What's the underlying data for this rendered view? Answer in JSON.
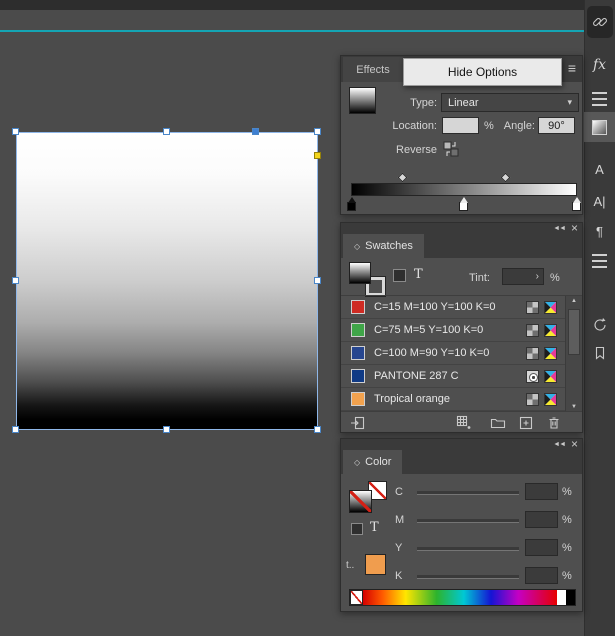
{
  "icons": {
    "menu": "≡",
    "collapse": "◄◄",
    "close": "×",
    "diamond": "◇",
    "chevron_down": "▾",
    "chevron_right": "›",
    "scroll_up": "▲",
    "scroll_down": "▼",
    "fx": "fx",
    "character": "A",
    "character_styles": "A|",
    "paragraph": "¶",
    "text_tool": "T",
    "tint_abbrev": "t.."
  },
  "colors": {
    "guide_teal": "#14a5b4",
    "selection_blue": "#4a86c8",
    "corner_widget_yellow": "#f3d51c",
    "panel_background": "#4f4f4f"
  },
  "gradient_panel": {
    "tab_label": "Effects",
    "menu_popup_label": "Hide Options",
    "type_label": "Type:",
    "type_value": "Linear",
    "location_label": "Location:",
    "location_value": "",
    "location_unit": "%",
    "angle_label": "Angle:",
    "angle_value": "90°",
    "reverse_label": "Reverse",
    "ramp": {
      "start_color": "#000000",
      "end_color": "#ffffff",
      "stop_positions_pct": [
        0,
        50,
        100
      ],
      "midpoint_positions_pct": [
        23,
        69
      ]
    }
  },
  "swatches_panel": {
    "title": "Swatches",
    "tint_label": "Tint:",
    "tint_unit": "%",
    "rows": [
      {
        "name": "C=15 M=100 Y=100 K=0",
        "color": "#cf2b23",
        "type": "process"
      },
      {
        "name": "C=75 M=5 Y=100 K=0",
        "color": "#3fa548",
        "type": "process"
      },
      {
        "name": "C=100 M=90 Y=10 K=0",
        "color": "#27468f",
        "type": "process"
      },
      {
        "name": "PANTONE 287 C",
        "color": "#0f3a85",
        "type": "spot"
      },
      {
        "name": "Tropical orange",
        "color": "#f2a24e",
        "type": "process"
      }
    ]
  },
  "color_panel": {
    "title": "Color",
    "channels": [
      "C",
      "M",
      "Y",
      "K"
    ],
    "unit": "%",
    "last_used_color": "#f09d4e"
  }
}
